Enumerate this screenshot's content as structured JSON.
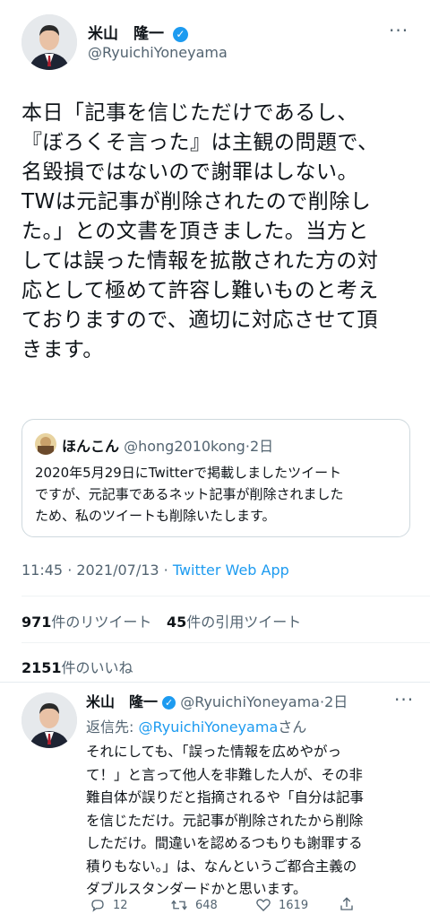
{
  "tweet": {
    "author_name": "米山　隆一",
    "author_handle": "@RyuichiYoneyama",
    "more_icon": "more-dots-icon",
    "lines": [
      "本日「記事を信じただけであるし、",
      "『ぼろくそ言った』は主観の問題で、",
      "名毀損ではないので謝罪はしない。",
      "TWは元記事が削除されたので削除し",
      "た。」との文書を頂きました。当方と",
      "しては誤った情報を拡散された方の対",
      "応として極めて許容し難いものと考え",
      "ておりますので、適切に対応させて頂",
      "きます。"
    ],
    "quote": {
      "name": "ほんこん",
      "handle": "@hong2010kong",
      "sep": "·",
      "time": "2日",
      "lines": [
        "2020年5月29日にTwitterで掲載しましたツイート",
        "ですが、元記事であるネット記事が削除されました",
        "ため、私のツイートも削除いたします。"
      ]
    },
    "meta_time": "11:45 · 2021/07/13 · ",
    "meta_source": "Twitter Web App",
    "retweets_count": "971",
    "retweets_label": "件のリツイート",
    "quotes_count": "45",
    "quotes_label": "件の引用ツイート",
    "likes_count": "2151",
    "likes_label": "件のいいね"
  },
  "reply": {
    "author_name": "米山　隆一",
    "author_handle": "@RyuichiYoneyama",
    "sep": "·",
    "time": "2日",
    "reply_to_label": "返信先: ",
    "reply_to_handle": "@RyuichiYoneyama",
    "reply_to_suffix": "さん",
    "lines": [
      "それにしても、「誤った情報を広めやがっ",
      "て！」と言って他人を非難した人が、その非",
      "難自体が誤りだと指摘されるや「自分は記事",
      "を信じただけ。元記事が削除されたから削除",
      "しただけ。間違いを認めるつもりも謝罪する",
      "積りもない。」は、なんというご都合主義の",
      "ダブルスタンダードかと思います。"
    ],
    "reply_count": "12",
    "retweet_count": "648",
    "like_count": "1619"
  },
  "colors": {
    "accent": "#1d9bf0",
    "muted": "#536471",
    "text": "#0f1419",
    "border": "#cfd9de"
  },
  "icons": [
    "verified-badge-icon",
    "more-dots-icon",
    "reply-icon",
    "retweet-icon",
    "like-icon",
    "share-icon"
  ]
}
